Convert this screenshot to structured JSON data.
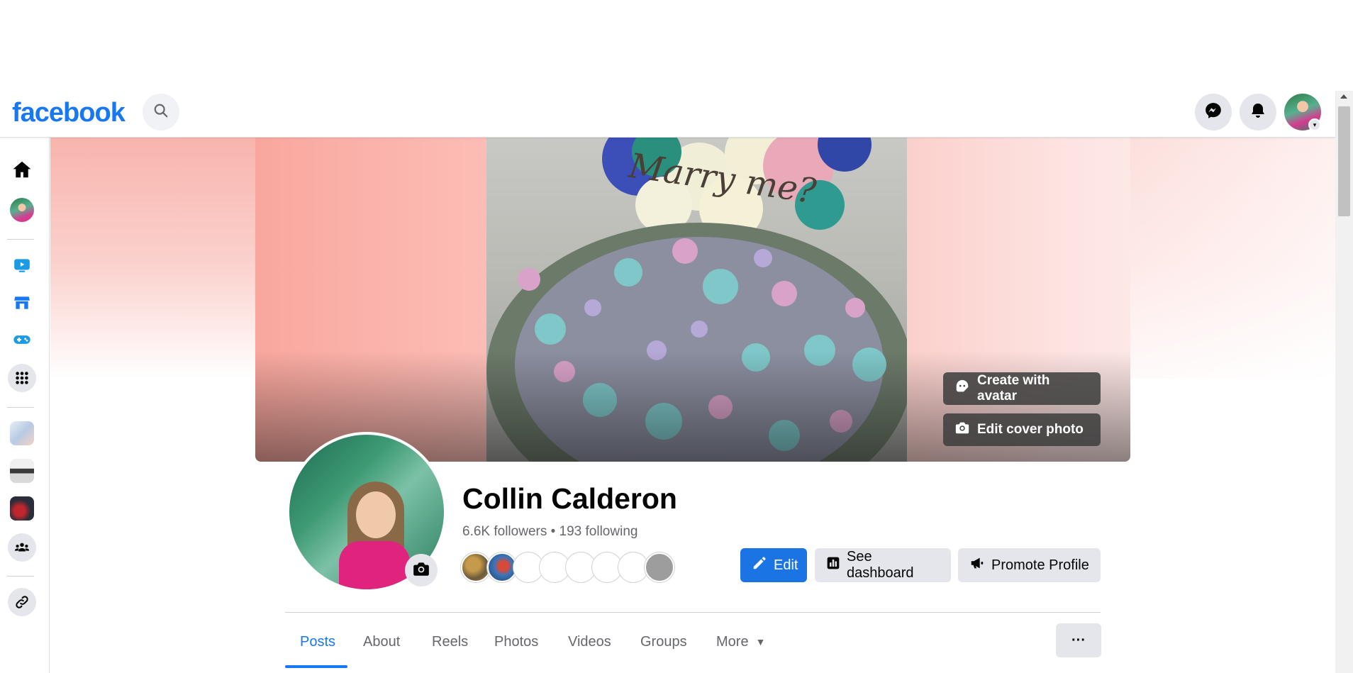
{
  "header": {
    "logo_text": "facebook",
    "icons": [
      "search-icon",
      "messenger-icon",
      "notifications-icon",
      "account-avatar"
    ]
  },
  "rail": {
    "items": [
      "home-icon",
      "profile-avatar",
      "video-icon",
      "marketplace-icon",
      "gaming-icon",
      "menu-grid-icon",
      "shortcut-1",
      "shortcut-2",
      "shortcut-3",
      "groups-icon",
      "link-icon"
    ]
  },
  "cover": {
    "photo_text": "Marry me?",
    "create_avatar_label": "Create with avatar",
    "edit_cover_label": "Edit cover photo"
  },
  "profile": {
    "name": "Collin Calderon",
    "stats": "6.6K followers • 193 following",
    "edit_label": "Edit",
    "dashboard_label": "See dashboard",
    "promote_label": "Promote Profile"
  },
  "tabs": [
    {
      "label": "Posts",
      "active": true
    },
    {
      "label": "About"
    },
    {
      "label": "Reels"
    },
    {
      "label": "Photos"
    },
    {
      "label": "Videos"
    },
    {
      "label": "Groups"
    },
    {
      "label": "More"
    }
  ],
  "more_options_label": "···",
  "colors": {
    "brand": "#1877f2",
    "button_blue": "#1b74e4",
    "button_gray": "#e4e6eb",
    "text_primary": "#050505",
    "text_secondary": "#65676b"
  }
}
